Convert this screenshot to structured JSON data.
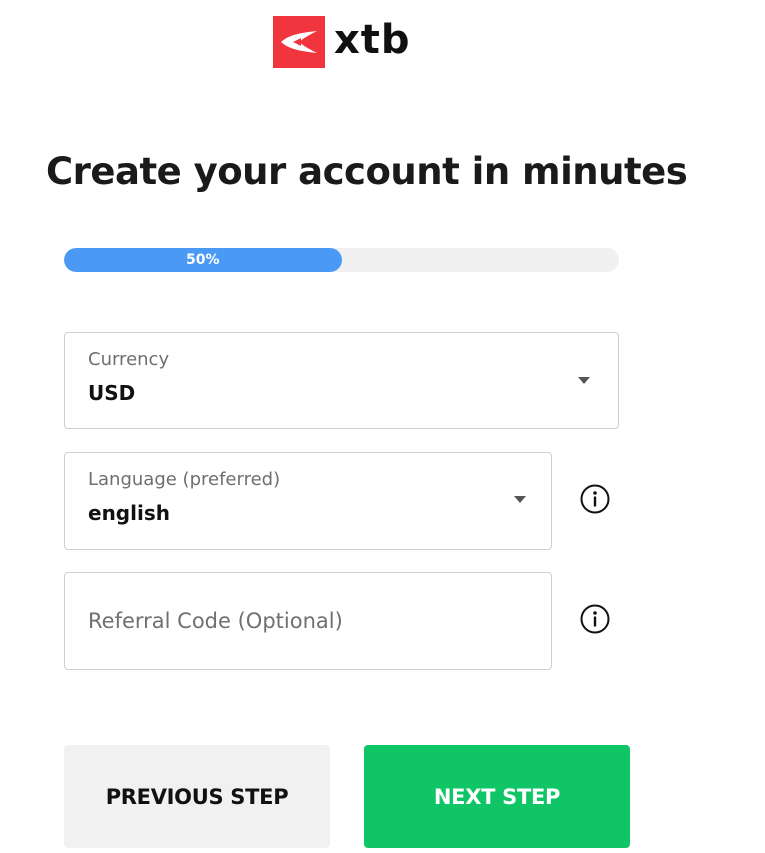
{
  "brand": {
    "name": "xtb",
    "logo_color": "#f0353f"
  },
  "page": {
    "title": "Create your account in minutes"
  },
  "progress": {
    "percent": 50,
    "label": "50%"
  },
  "form": {
    "currency": {
      "label": "Currency",
      "value": "USD"
    },
    "language": {
      "label": "Language (preferred)",
      "value": "english"
    },
    "referral": {
      "placeholder": "Referral Code (Optional)",
      "value": ""
    }
  },
  "icons": {
    "info": "info-icon",
    "dropdown": "caret-down-icon"
  },
  "buttons": {
    "previous": "PREVIOUS STEP",
    "next": "NEXT STEP"
  },
  "colors": {
    "progress_fill": "#4a9af5",
    "next_button": "#0fc566",
    "previous_button": "#f1f1f1"
  }
}
